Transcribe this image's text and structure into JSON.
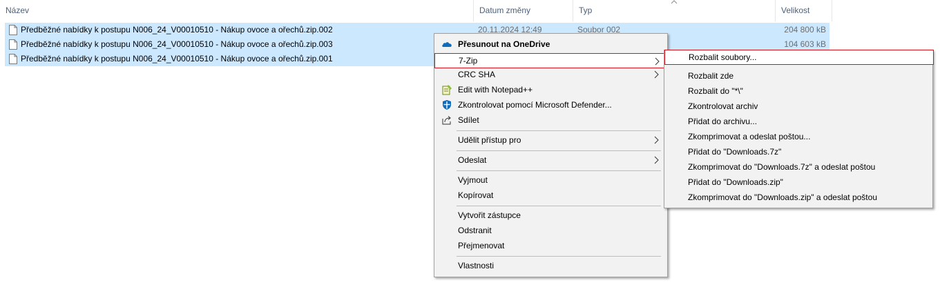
{
  "columns": {
    "name": "Název",
    "date": "Datum změny",
    "type": "Typ",
    "size": "Velikost"
  },
  "files": [
    {
      "name": "Předběžné nabídky k postupu N006_24_V00010510 - Nákup ovoce a ořechů.zip.002",
      "date": "20.11.2024 12:49",
      "type": "Soubor 002",
      "size": "204 800 kB"
    },
    {
      "name": "Předběžné nabídky k postupu N006_24_V00010510 - Nákup ovoce a ořechů.zip.003",
      "date": "",
      "type": "",
      "size": "104 603 kB"
    },
    {
      "name": "Předběžné nabídky k postupu N006_24_V00010510 - Nákup ovoce a ořechů.zip.001",
      "date": "",
      "type": "",
      "size": ""
    }
  ],
  "context_menu": {
    "onedrive": "Přesunout na OneDrive",
    "sevenzip": "7-Zip",
    "crc": "CRC SHA",
    "notepad": "Edit with Notepad++",
    "defender": "Zkontrolovat pomocí Microsoft Defender...",
    "share": "Sdílet",
    "grant_access": "Udělit přístup pro",
    "send_to": "Odeslat",
    "cut": "Vyjmout",
    "copy": "Kopírovat",
    "shortcut": "Vytvořit zástupce",
    "delete": "Odstranit",
    "rename": "Přejmenovat",
    "properties": "Vlastnosti"
  },
  "submenu": {
    "items": [
      "Rozbalit soubory...",
      "Rozbalit zde",
      "Rozbalit do \"*\\\"",
      "Zkontrolovat archiv",
      "Přidat do archivu...",
      "Zkomprimovat a odeslat poštou...",
      "Přidat do \"Downloads.7z\"",
      "Zkomprimovat do \"Downloads.7z\" a odeslat poštou",
      "Přidat do \"Downloads.zip\"",
      "Zkomprimovat do \"Downloads.zip\" a odeslat poštou"
    ]
  },
  "colors": {
    "selection": "#cce8ff",
    "menu_bg": "#f2f2f2",
    "highlight_border": "#d6121c",
    "header_text": "#4c607a"
  }
}
